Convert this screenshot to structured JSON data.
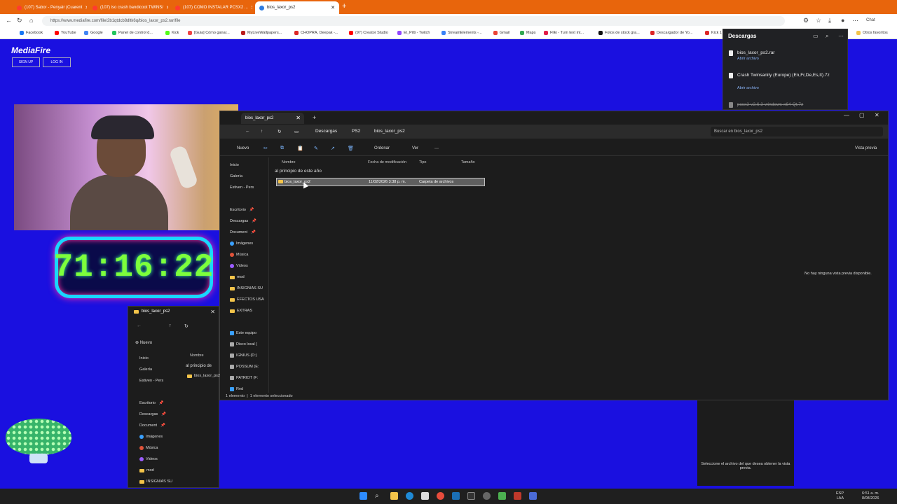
{
  "browser": {
    "tabs": [
      {
        "label": "(107) Sabor - Penyair (Cuarent"
      },
      {
        "label": "(107) iso crash bandicoot TWINS/"
      },
      {
        "label": "(107) COMO INSTALAR PCSX2 ..."
      },
      {
        "label": "bios_laxor_ps2"
      }
    ],
    "url": "https://www.mediafire.com/file/2b1qtdcb8dltk6q/bios_laxor_ps2.rar/file",
    "bookmarks": [
      "Facebook",
      "YouTube",
      "Google",
      "Panel de control d...",
      "Kick",
      "[Guia] Cómo ganar...",
      "MyLiveWallpapers...",
      "CHOPRA, Deepak -...",
      "(97) Creator Studio",
      "El_Pitti - Twitch",
      "StreamElements -...",
      "Gmail",
      "Maps",
      "Fliki - Turn text int...",
      "Fotos de stock gra...",
      "Descargador de Yo...",
      "Kick 1",
      "Otros favoritos"
    ],
    "chat_label": "Chat"
  },
  "mediafire": {
    "logo": "MediaFire",
    "signup": "SIGN UP",
    "login": "LOG IN"
  },
  "timer": "71:16:22",
  "downloads": {
    "title": "Descargas",
    "items": [
      {
        "name": "bios_laxor_ps2.rar",
        "action": "Abrir archivo"
      },
      {
        "name": "Crash Twinsanity (Europe) (En,Fr,De,Es,It).7z",
        "action": "Abrir archivo"
      },
      {
        "name": "pcsx2-v2.6.3-windows-x64-Qt.7z",
        "action": ""
      }
    ]
  },
  "explorer": {
    "tab_title": "bios_laxor_ps2",
    "breadcrumbs": [
      "Descargas",
      "PS2",
      "bios_laxor_ps2"
    ],
    "search_placeholder": "Buscar en bios_laxor_ps2",
    "commands": {
      "new": "Nuevo",
      "sort": "Ordenar",
      "view": "Ver",
      "preview": "Vista previa"
    },
    "nav": [
      "Inicio",
      "Galería",
      "Estiven - Pers",
      "Escritorio",
      "Descargas",
      "Document",
      "Imágenes",
      "Música",
      "Videos",
      "mod",
      "INSIGNIAS SU",
      "EFECTOS USA",
      "EXTRAS",
      "Este equipo",
      "Disco local (",
      "IGNIUS (D:)",
      "POSSUM (E:",
      "PATRIOT (F:",
      "Red"
    ],
    "columns": [
      "Nombre",
      "Fecha de modificación",
      "Tipo",
      "Tamaño"
    ],
    "group": "al principio de este año",
    "row": {
      "name": "bios_laxor_ps2",
      "date": "11/02/2026 3:38 p. m.",
      "type": "Carpeta de archivos",
      "size": ""
    },
    "preview_msg": "No hay ninguna vista previa disponible.",
    "status_count": "1 elemento",
    "status_sel": "1 elemento seleccionado"
  },
  "explorer2": {
    "title": "bios_laxor_ps2",
    "new": "Nuevo",
    "nav": [
      "Inicio",
      "Galería",
      "Estiven - Pers",
      "Escritorio",
      "Descargas",
      "Document",
      "Imágenes",
      "Música",
      "Videos",
      "mod",
      "INSIGNIAS SU"
    ],
    "col": "Nombre",
    "group": "al principio de",
    "row": "bios_laxor_ps2"
  },
  "preview2_msg": "Seleccione el archivo del que desea obtener la vista previa.",
  "taskbar": {
    "lang": "ESP",
    "lang2": "LAA",
    "time": "6:51 a. m.",
    "date": "8/08/2026"
  }
}
